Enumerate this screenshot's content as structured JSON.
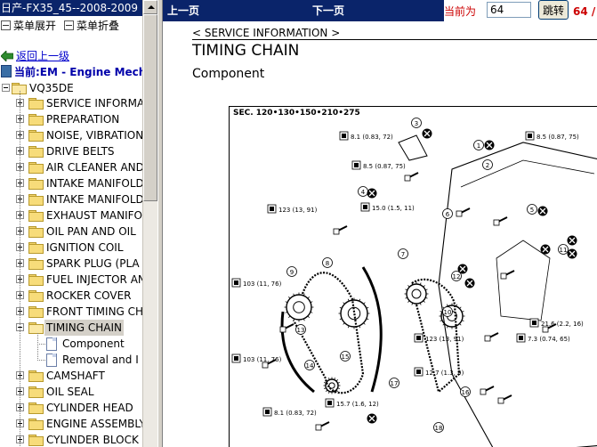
{
  "window": {
    "title": "日产-FX35_45--2008-2009"
  },
  "menu": {
    "expand_label": "菜单展开",
    "collapse_label": "菜单折叠"
  },
  "nav": {
    "back_label": "返回上一级",
    "current_label": "当前:EM - Engine Mechanical"
  },
  "tree": {
    "root": "VQ35DE",
    "items": [
      "SERVICE INFORMATION",
      "PREPARATION",
      "NOISE, VIBRATION",
      "DRIVE BELTS",
      "AIR CLEANER AND",
      "INTAKE MANIFOLD",
      "INTAKE MANIFOLD",
      "EXHAUST MANIFOLD",
      "OIL PAN AND OIL",
      "IGNITION COIL",
      "SPARK PLUG (PLA",
      "FUEL INJECTOR AN",
      "ROCKER COVER",
      "FRONT TIMING CH"
    ],
    "selected": "TIMING CHAIN",
    "children": [
      "Component",
      "Removal and I"
    ],
    "items_after": [
      "CAMSHAFT",
      "OIL SEAL",
      "CYLINDER HEAD",
      "ENGINE ASSEMBLY",
      "CYLINDER BLOCK"
    ]
  },
  "toolbar": {
    "prev_label": "上一页",
    "next_label": "下一页",
    "current_page_label": "当前为",
    "current_page_value": "64",
    "goto_label": "跳转",
    "total_pages": "64 /"
  },
  "document": {
    "section_header": "< SERVICE INFORMATION >",
    "title": "TIMING CHAIN",
    "subtitle": "Component",
    "diagram_sec": "SEC. 120•130•150•210•275",
    "callouts": [
      {
        "n": "3",
        "torque": "8.1 (0.83, 72)"
      },
      {
        "n": "1",
        "torque": "8.5 (0.87, 75)"
      },
      {
        "n": "",
        "torque": "8.5 (0.87, 75)"
      },
      {
        "n": "",
        "torque": "123 (13, 91)"
      },
      {
        "n": "",
        "torque": "15.0 (1.5, 11)"
      },
      {
        "n": "",
        "torque": "103 (11, 76)"
      },
      {
        "n": "",
        "torque": "123 (13, 91)"
      },
      {
        "n": "",
        "torque": "21.6 (2.2, 16)"
      },
      {
        "n": "",
        "torque": "7.3 (0.74, 65)"
      },
      {
        "n": "",
        "torque": "103 (11, 76)"
      },
      {
        "n": "",
        "torque": "12.7 (1.3, 9)"
      },
      {
        "n": "",
        "torque": "15.7 (1.6, 12)"
      },
      {
        "n": "",
        "torque": "8.1 (0.83, 72)"
      }
    ]
  }
}
